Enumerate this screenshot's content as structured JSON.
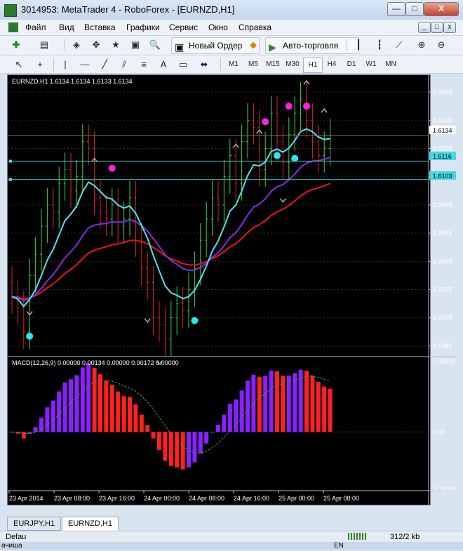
{
  "window": {
    "title": "3014953: MetaTrader 4 - RoboForex - [EURNZD,H1]",
    "min_label": "—",
    "max_label": "□",
    "close_label": "X",
    "inner_min_label": "_",
    "inner_restore_label": "□",
    "inner_close_label": "x"
  },
  "menu": {
    "items": [
      "Файл",
      "Вид",
      "Вставка",
      "Графики",
      "Сервис",
      "Окно",
      "Справка"
    ]
  },
  "toolbar1": {
    "new_order_label": "Новый Ордер",
    "autotrade_label": "Авто-торговля"
  },
  "timeframes": {
    "items": [
      "M1",
      "M5",
      "M15",
      "M30",
      "H1",
      "H4",
      "D1",
      "W1",
      "MN"
    ],
    "active": "H1"
  },
  "chart": {
    "symbol_header": "EURNZD,H1  1.6134 1.6134 1.6133 1.6134",
    "price_ticks": [
      "1.6165",
      "1.6145",
      "1.6125",
      "1.6105",
      "1.6085",
      "1.6065",
      "1.6045",
      "1.6025",
      "1.6005",
      "1.5985"
    ],
    "current_price": "1.6134",
    "hline1_label": "1.6116",
    "hline2_label": "1.6103",
    "macd_header": "MACD(12,26,9) 0.00000 0.00134 0.00000 0.00172 0.00000",
    "macd_ticks": [
      "0.00229",
      "0.00",
      "-0.00186"
    ],
    "time_labels": [
      "23 Apr 2014",
      "23 Apr 08:00",
      "23 Apr 16:00",
      "24 Apr 00:00",
      "24 Apr 08:00",
      "24 Apr 16:00",
      "25 Apr 00:00",
      "25 Apr 08:00"
    ]
  },
  "colors": {
    "bull": "#3cd63c",
    "bear": "#e02020",
    "ma_cyan": "#4fe6f0",
    "ma_purple": "#8a2be2",
    "ma_red": "#e81818",
    "hline": "#41d9e6",
    "dot_magenta": "#ff22dd",
    "dot_cyan": "#22e8f0",
    "macd_up": "#8a20ff",
    "macd_down": "#ff2020",
    "signal": "#40a040"
  },
  "tabs": {
    "items": [
      "EURJPY,H1",
      "EURNZD,H1"
    ],
    "active": "EURNZD,H1"
  },
  "status": {
    "left_text": "Defau",
    "traffic": "312/2 kb",
    "lang": "EN",
    "task_left": "ачиша"
  }
}
